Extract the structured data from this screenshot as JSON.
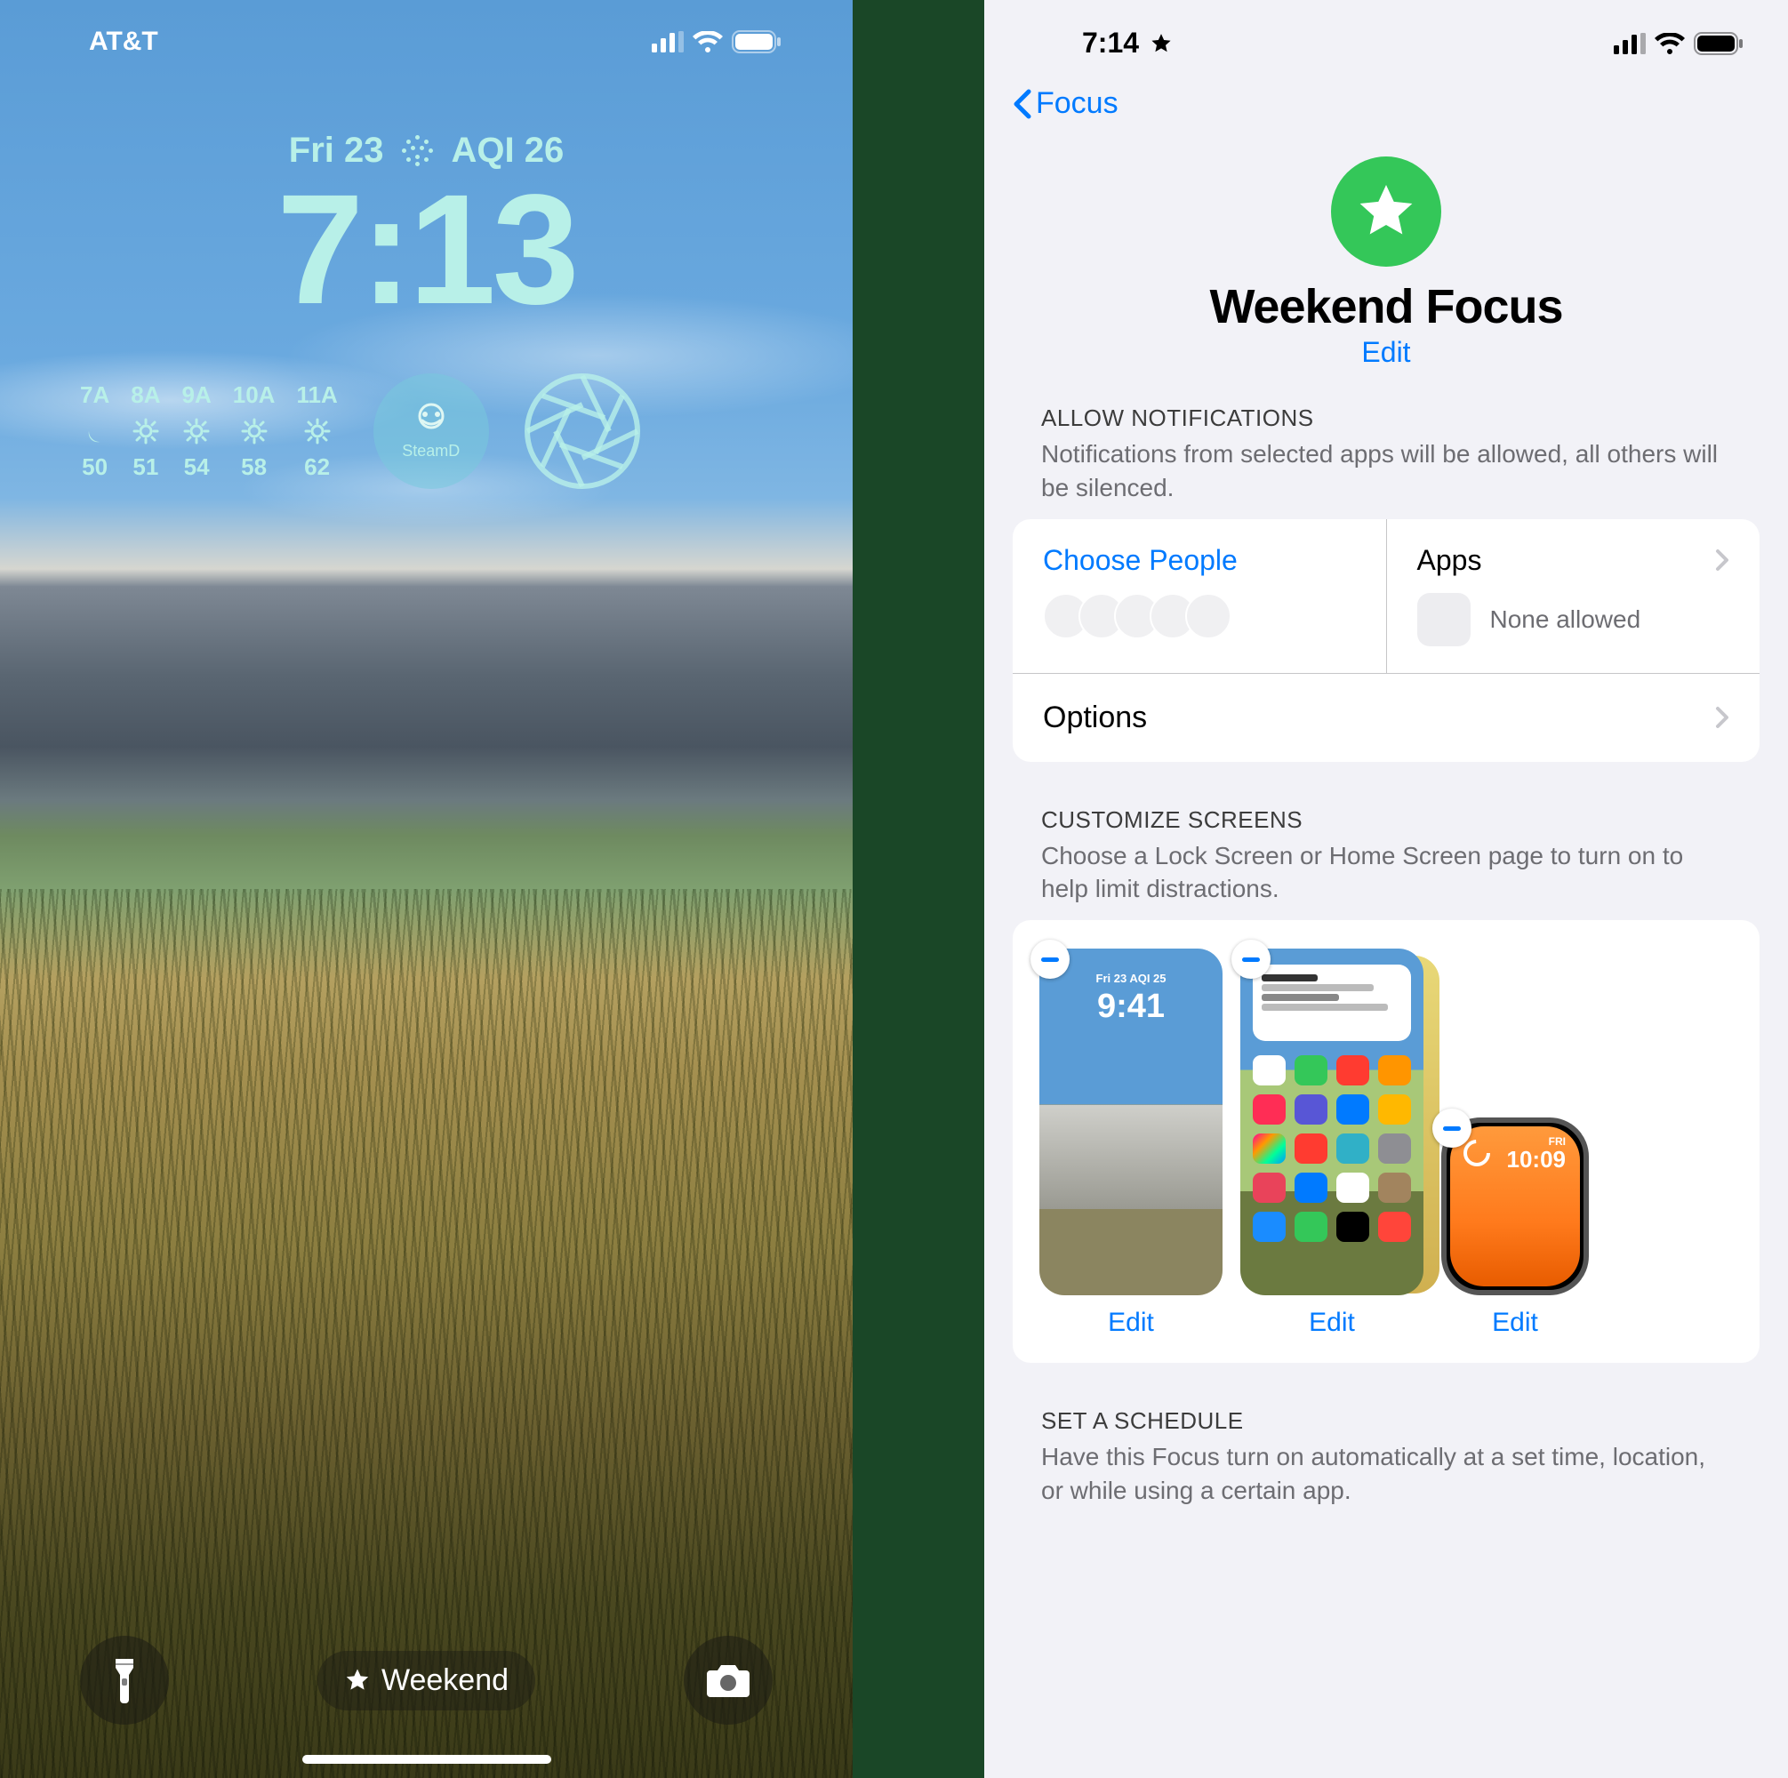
{
  "lock": {
    "carrier": "AT&T",
    "date": "Fri 23",
    "aqi": "AQI 26",
    "time": "7:13",
    "weather": [
      {
        "hour": "7A",
        "icon": "moon",
        "temp": "50"
      },
      {
        "hour": "8A",
        "icon": "sun",
        "temp": "51"
      },
      {
        "hour": "9A",
        "icon": "sun",
        "temp": "54"
      },
      {
        "hour": "10A",
        "icon": "sun",
        "temp": "58"
      },
      {
        "hour": "11A",
        "icon": "sun",
        "temp": "62"
      }
    ],
    "steam_label": "SteamD",
    "focus_name": "Weekend"
  },
  "settings": {
    "time": "7:14",
    "back": "Focus",
    "title": "Weekend Focus",
    "edit": "Edit",
    "notif": {
      "header": "ALLOW NOTIFICATIONS",
      "desc": "Notifications from selected apps will be allowed, all others will be silenced.",
      "people_label": "Choose People",
      "apps_label": "Apps",
      "apps_sub": "None allowed",
      "options": "Options"
    },
    "customize": {
      "header": "CUSTOMIZE SCREENS",
      "desc": "Choose a Lock Screen or Home Screen page to turn on to help limit distractions.",
      "lock_time": "9:41",
      "lock_date": "Fri 23   AQI 25",
      "watch_time": "10:09",
      "watch_day": "FRI",
      "edit": "Edit"
    },
    "schedule": {
      "header": "SET A SCHEDULE",
      "desc": "Have this Focus turn on automatically at a set time, location, or while using a certain app."
    }
  }
}
